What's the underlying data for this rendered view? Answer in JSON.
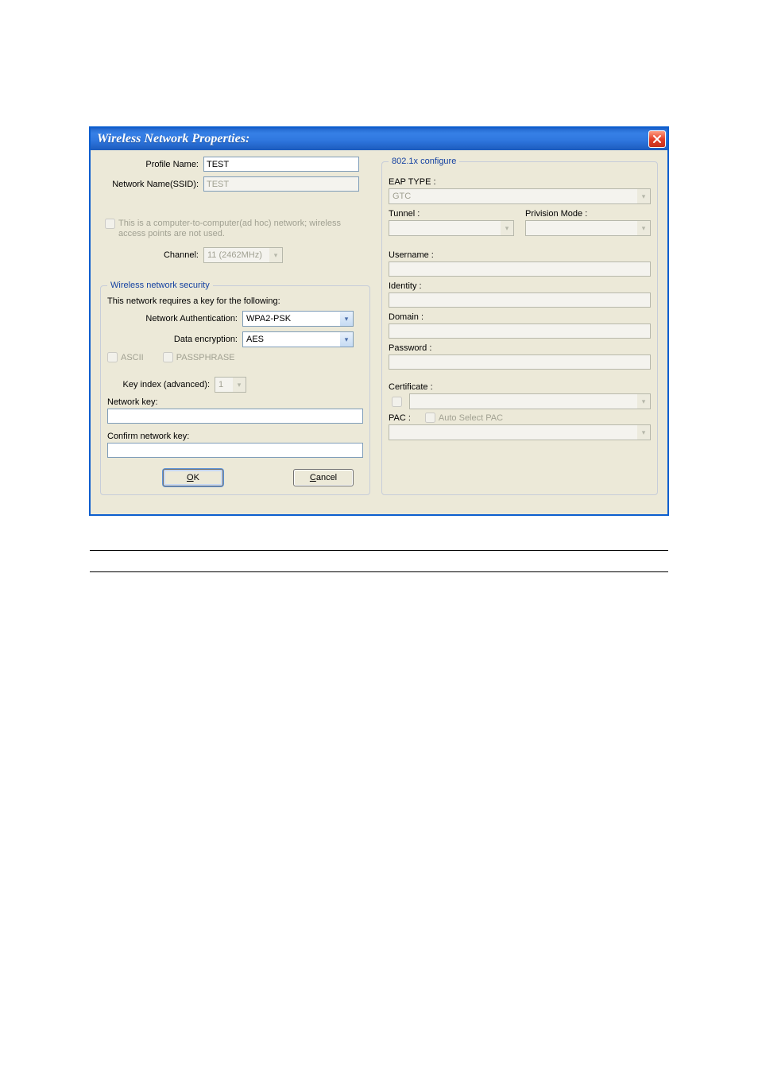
{
  "dialog": {
    "title": "Wireless Network Properties:"
  },
  "left": {
    "profile_name_label": "Profile Name:",
    "profile_name_value": "TEST",
    "ssid_label": "Network Name(SSID):",
    "ssid_value": "TEST",
    "adhoc_label": "This is a computer-to-computer(ad hoc) network; wireless access points are not used.",
    "channel_label": "Channel:",
    "channel_value": "11 (2462MHz)",
    "security_legend": "Wireless network security",
    "security_note": "This network requires a key for the following:",
    "auth_label": "Network Authentication:",
    "auth_value": "WPA2-PSK",
    "enc_label": "Data encryption:",
    "enc_value": "AES",
    "ascii_label": "ASCII",
    "pass_label": "PASSPHRASE",
    "keyidx_label": "Key index (advanced):",
    "keyidx_value": "1",
    "netkey_label": "Network key:",
    "confirm_label": "Confirm network key:",
    "ok_label": "OK",
    "cancel_label": "Cancel"
  },
  "right": {
    "legend": "802.1x configure",
    "eap_label": "EAP TYPE :",
    "eap_value": "GTC",
    "tunnel_label": "Tunnel :",
    "prov_label": "Privision Mode :",
    "username_label": "Username :",
    "identity_label": "Identity :",
    "domain_label": "Domain :",
    "password_label": "Password :",
    "cert_label": "Certificate :",
    "pac_label": "PAC :",
    "autopac_label": "Auto Select PAC"
  }
}
